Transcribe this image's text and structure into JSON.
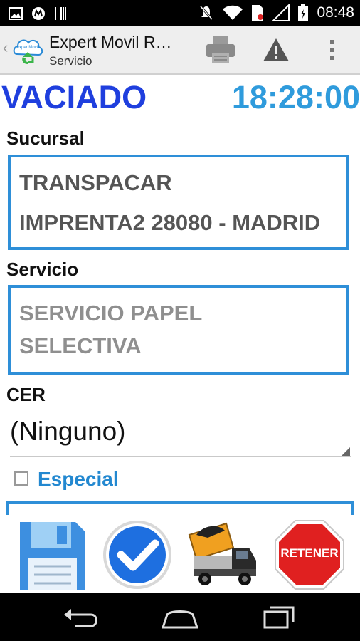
{
  "status_bar": {
    "time": "08:48"
  },
  "action_bar": {
    "back_glyph": "‹",
    "logo_text": "expertMovil",
    "title": "Expert Movil R…",
    "subtitle": "Servicio",
    "icons": [
      "printer-icon",
      "warning-icon",
      "overflow-menu-icon"
    ]
  },
  "header": {
    "status": "VACIADO",
    "time": "18:28:00"
  },
  "sucursal": {
    "label": "Sucursal",
    "line1": "TRANSPACAR",
    "line2": "IMPRENTA2 28080 - MADRID"
  },
  "servicio": {
    "label": "Servicio",
    "line1": "SERVICIO PAPEL",
    "line2": "SELECTIVA"
  },
  "cer": {
    "label": "CER",
    "selected": "(Ninguno)"
  },
  "especial": {
    "label": "Especial",
    "checked": false
  },
  "toolbar": {
    "retener_label": "RETENER",
    "icons": [
      "save-icon",
      "confirm-icon",
      "unload-truck-icon",
      "retener-icon"
    ]
  },
  "colors": {
    "status_blue": "#1f3fde",
    "time_blue": "#2f9bdc",
    "border_blue": "#2e8fd8",
    "accent_blue": "#2388d0",
    "retener_red": "#e02020"
  }
}
